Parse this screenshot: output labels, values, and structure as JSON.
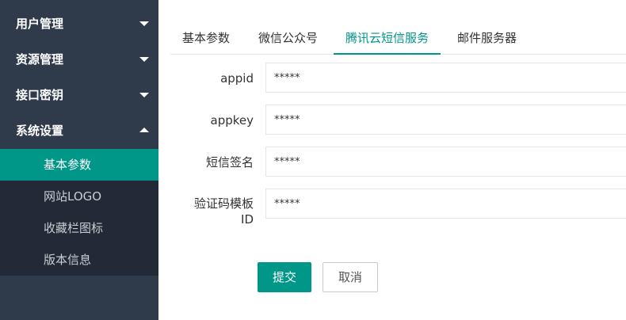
{
  "sidebar": {
    "menus": [
      {
        "label": "用户管理",
        "expanded": false
      },
      {
        "label": "资源管理",
        "expanded": false
      },
      {
        "label": "接口密钥",
        "expanded": false
      },
      {
        "label": "系统设置",
        "expanded": true
      }
    ],
    "submenu": [
      {
        "label": "基本参数",
        "active": true
      },
      {
        "label": "网站LOGO",
        "active": false
      },
      {
        "label": "收藏栏图标",
        "active": false
      },
      {
        "label": "版本信息",
        "active": false
      }
    ]
  },
  "tabs": [
    {
      "label": "基本参数"
    },
    {
      "label": "微信公众号"
    },
    {
      "label": "腾讯云短信服务",
      "active": true
    },
    {
      "label": "邮件服务器"
    }
  ],
  "form": {
    "fields": [
      {
        "label": "appid",
        "value": "*****"
      },
      {
        "label": "appkey",
        "value": "*****"
      },
      {
        "label": "短信签名",
        "value": "*****"
      },
      {
        "label_line1": "验证码模板",
        "label_line2": "ID",
        "value": "*****"
      }
    ],
    "submit_label": "提交",
    "cancel_label": "取消"
  },
  "colors": {
    "sidebar_bg": "#2f3a4b",
    "submenu_bg": "#212a36",
    "accent": "#009688"
  }
}
